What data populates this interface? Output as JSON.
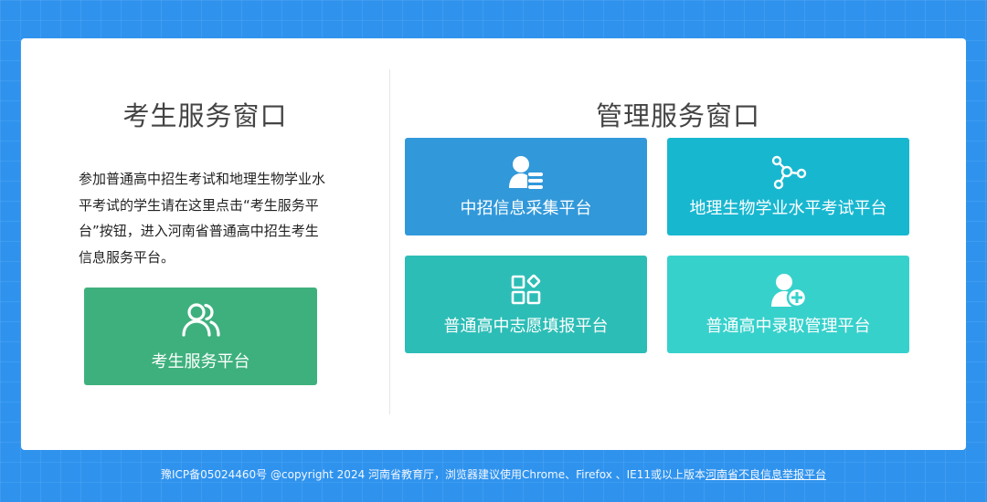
{
  "student": {
    "title": "考生服务窗口",
    "description": "参加普通高中招生考试和地理生物学业水平考试的学生请在这里点击“考生服务平台”按钮，进入河南省普通高中招生考生信息服务平台。",
    "button": {
      "label": "考生服务平台",
      "icon": "users-icon",
      "color": "#3eb07d"
    }
  },
  "admin": {
    "title": "管理服务窗口",
    "tiles": [
      {
        "label": "中招信息采集平台",
        "icon": "user-list-icon",
        "color": "#3198da"
      },
      {
        "label": "地理生物学业水平考试平台",
        "icon": "network-icon",
        "color": "#18b7d0"
      },
      {
        "label": "普通高中志愿填报平台",
        "icon": "apps-grid-icon",
        "color": "#2cbdb6"
      },
      {
        "label": "普通高中录取管理平台",
        "icon": "user-add-icon",
        "color": "#37d1cc"
      }
    ]
  },
  "footer": {
    "text": "豫ICP备05024460号 @copyright 2024 河南省教育厅，浏览器建议使用Chrome、Firefox 、IE11或以上版本",
    "link": "河南省不良信息举报平台"
  },
  "colors": {
    "background": "#2f93ee",
    "card": "#ffffff"
  }
}
